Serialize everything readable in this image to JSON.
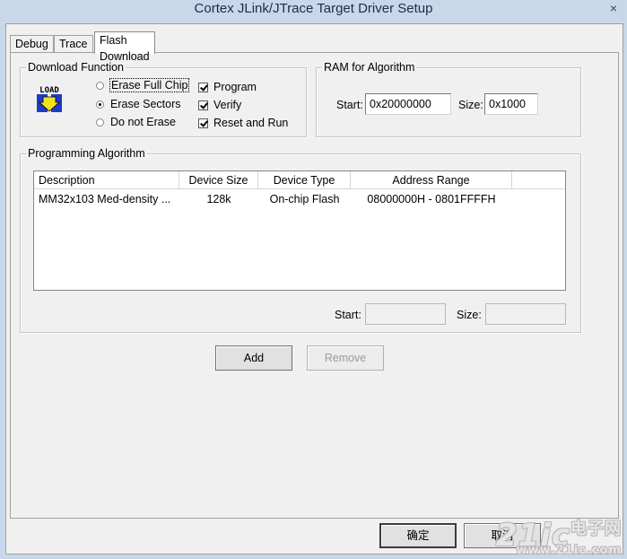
{
  "window": {
    "title": "Cortex JLink/JTrace Target Driver Setup",
    "close_glyph": "×"
  },
  "tabs": [
    {
      "label": "Debug",
      "active": false
    },
    {
      "label": "Trace",
      "active": false
    },
    {
      "label": "Flash Download",
      "active": true
    }
  ],
  "download_function": {
    "group_label": "Download Function",
    "icon": "load-icon",
    "icon_text": "LOAD",
    "radios": [
      {
        "label": "Erase Full Chip",
        "selected": false
      },
      {
        "label": "Erase Sectors",
        "selected": true
      },
      {
        "label": "Do not Erase",
        "selected": false
      }
    ],
    "checks": [
      {
        "label": "Program",
        "checked": true
      },
      {
        "label": "Verify",
        "checked": true
      },
      {
        "label": "Reset and Run",
        "checked": true
      }
    ]
  },
  "ram": {
    "group_label": "RAM for Algorithm",
    "start_label": "Start:",
    "start_value": "0x20000000",
    "size_label": "Size:",
    "size_value": "0x1000"
  },
  "programming_algorithm": {
    "group_label": "Programming Algorithm",
    "columns": [
      "Description",
      "Device Size",
      "Device Type",
      "Address Range"
    ],
    "rows": [
      {
        "description": "MM32x103 Med-density ...",
        "size": "128k",
        "type": "On-chip Flash",
        "range": "08000000H - 0801FFFFH"
      }
    ],
    "start_label": "Start:",
    "start_value": "",
    "size_label": "Size:",
    "size_value": ""
  },
  "buttons": {
    "add": "Add",
    "remove": "Remove",
    "ok": "确定",
    "cancel": "取消"
  },
  "watermark": {
    "brand": "21ic",
    "cn": "电子网",
    "url": "www.21ic.com"
  }
}
